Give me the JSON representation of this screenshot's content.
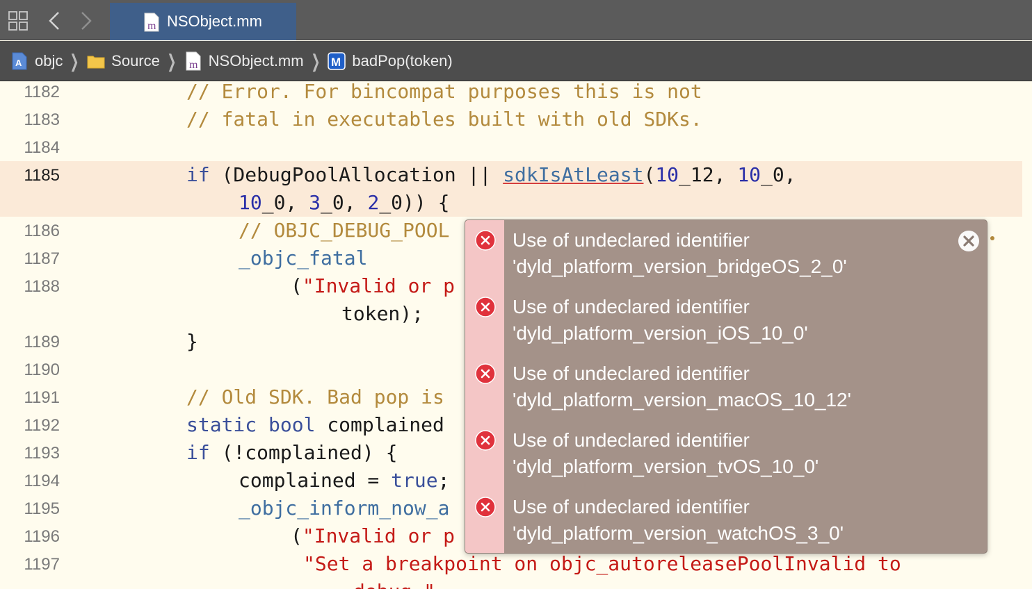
{
  "tab": {
    "label": "NSObject.mm"
  },
  "breadcrumb": [
    {
      "label": "objc",
      "icon": "xcode-project-icon"
    },
    {
      "label": "Source",
      "icon": "folder-icon"
    },
    {
      "label": "NSObject.mm",
      "icon": "objc-file-icon"
    },
    {
      "label": "badPop(token)",
      "icon": "method-icon"
    }
  ],
  "code": {
    "lines": [
      {
        "num": "1182",
        "text": "// Error. For bincompat purposes this is not"
      },
      {
        "num": "1183",
        "text": "// fatal in executables built with old SDKs."
      },
      {
        "num": "1184",
        "text": ""
      },
      {
        "num": "1185",
        "text_a": "if (DebugPoolAllocation || ",
        "fn": "sdkIsAtLeast",
        "text_b": "(10_12, 10_0,",
        "text_c": "10_0, 3_0, 2_0)) {"
      },
      {
        "num": "1186",
        "text": "// OBJC_DEBUG_POOL"
      },
      {
        "num": "1187",
        "text": "_objc_fatal"
      },
      {
        "num": "1188",
        "text_open": "(",
        "str": "\"Invalid or p",
        "cont": "token);"
      },
      {
        "num": "1189",
        "text": "}"
      },
      {
        "num": "1190",
        "text": ""
      },
      {
        "num": "1191",
        "text": "// Old SDK. Bad pop is"
      },
      {
        "num": "1192",
        "kw1": "static",
        "kw2": "bool",
        "text": "complained"
      },
      {
        "num": "1193",
        "kw": "if",
        "text": "(!complained) {"
      },
      {
        "num": "1194",
        "text": "complained = ",
        "kw": "true",
        "tail": ";"
      },
      {
        "num": "1195",
        "text": "_objc_inform_now_a"
      },
      {
        "num": "1196",
        "text_open": "(",
        "str": "\"Invalid or p"
      },
      {
        "num": "1197",
        "str": "\"Set a breakpoint on objc_autoreleasePoolInvalid to",
        "next": "debug.\""
      }
    ]
  },
  "errors": [
    {
      "line1": "Use of undeclared identifier",
      "line2": "'dyld_platform_version_bridgeOS_2_0'"
    },
    {
      "line1": "Use of undeclared identifier",
      "line2": "'dyld_platform_version_iOS_10_0'"
    },
    {
      "line1": "Use of undeclared identifier",
      "line2": "'dyld_platform_version_macOS_10_12'"
    },
    {
      "line1": "Use of undeclared identifier",
      "line2": "'dyld_platform_version_tvOS_10_0'"
    },
    {
      "line1": "Use of undeclared identifier",
      "line2": "'dyld_platform_version_watchOS_3_0'"
    }
  ],
  "colors": {
    "comment": "#b38a3d",
    "keyword": "#3a4f9a",
    "number": "#2a2fa8",
    "string": "#c41a16",
    "error": "#d43d3d",
    "tab_active": "#3f5f8a"
  }
}
